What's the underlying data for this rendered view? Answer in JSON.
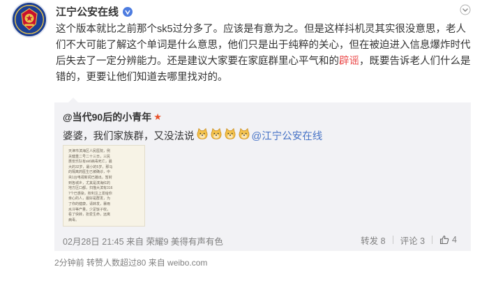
{
  "post": {
    "author": "江宁公安在线",
    "text_part1": "这个版本就比之前那个sk5过分多了。应该是有意为之。但是这样抖机灵其实很没意思，老人们不大可能了解这个单词是什么意思，他们只是出于纯粹的关心，但在被迫进入信息爆炸时代后失去了一定分辨能力。还是建议大家要在家庭群里心平气和的",
    "text_highlight": "辟谣",
    "text_part2": "，既要告诉老人们什么是错的，更要让他们知道去哪里找对的。",
    "footer": "2分钟前 转赞人数超过80 来自 weibo.com"
  },
  "repost": {
    "author": "@当代90后的小青年",
    "text": "婆婆，我们家族群，又没法说",
    "mention": "@江宁公安在线",
    "emoji_count": 4,
    "thumb_text": "天津市滨海区人民医院，例关健重二号二十三日，三民惠安乐队有sk6病毒死亡，最大的32岁，最小的5岁，那马的隔离药医生已被确诊，中央1台电视新闻已播出，暂封到各城乡，尤其是滨海红的地方区口都，扫描大滨有3167个已感染，权利注上发给你亲心的人，最好是群发，为了你的健康，请转发，暴雨水冷等产量，少足饭子收，看了快转，扮爱生命，远离病毒。",
    "meta": "02月28日 21:45 来自 荣耀9 美得有声有色",
    "forward_label": "转发 8",
    "comment_label": "评论 3",
    "like_count": "4"
  },
  "colors": {
    "text": "#333333",
    "link": "#4773c6",
    "highlight": "#eb4c4c",
    "repost_bg": "#f2f2f5",
    "meta": "#808080"
  }
}
